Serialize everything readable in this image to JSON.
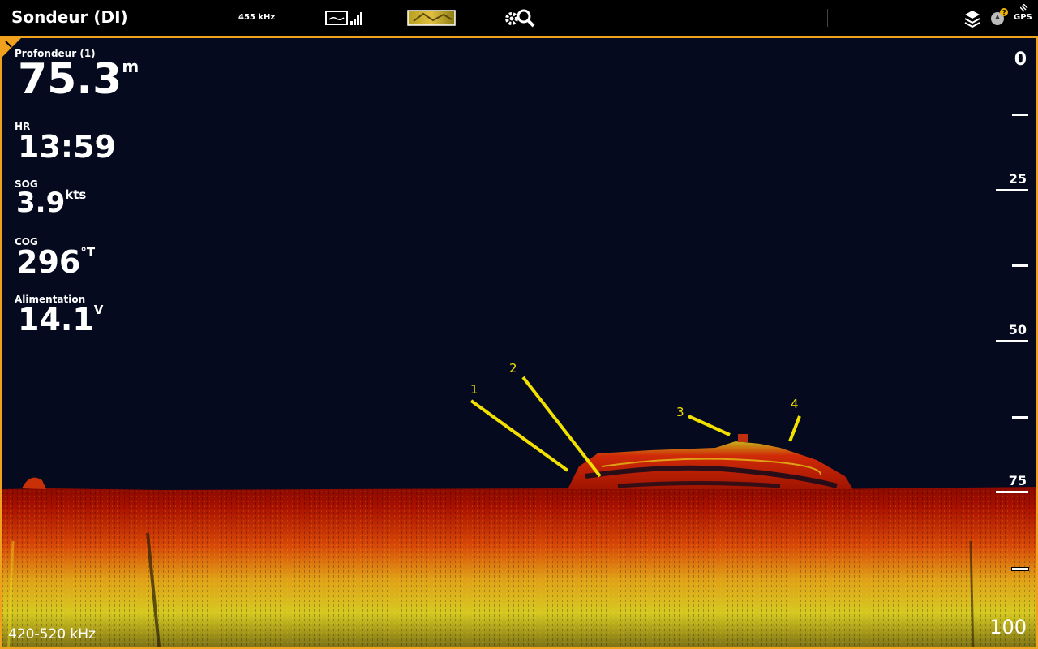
{
  "header": {
    "title": "Sondeur (DI)",
    "frequency": "455 kHz",
    "gps_label": "GPS",
    "icons": [
      "sonar-view-icon",
      "signal-bars-icon",
      "sidescan-thumbnail-icon",
      "settings-search-icon",
      "layers-icon",
      "compass-alert-icon",
      "gps-satellite-icon"
    ]
  },
  "readouts": {
    "depth": {
      "label": "Profondeur (1)",
      "value": "75.3",
      "unit": "m"
    },
    "time": {
      "label": "HR",
      "value": "13:59"
    },
    "sog": {
      "label": "SOG",
      "value": "3.9",
      "unit": "kts"
    },
    "cog": {
      "label": "COG",
      "value": "296",
      "unit": "°T"
    },
    "power": {
      "label": "Alimentation",
      "value": "14.1",
      "unit": "V"
    }
  },
  "depth_scale": {
    "labels": [
      "0",
      "25",
      "50",
      "75",
      "100"
    ]
  },
  "footer": {
    "frequency_range": "420-520 kHz"
  },
  "annotations": [
    "1",
    "2",
    "3",
    "4"
  ],
  "colors": {
    "accent": "#f0a21e",
    "water": "#050a1e",
    "annotation": "#f2e100",
    "sonar_red": "#b01000",
    "sonar_yellow": "#e8d41a"
  }
}
